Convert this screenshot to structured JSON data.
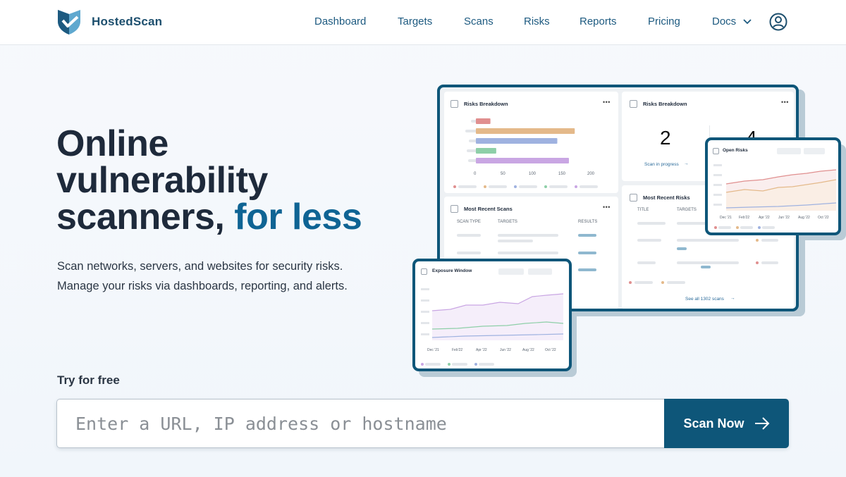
{
  "brand": {
    "name": "HostedScan"
  },
  "nav": {
    "items": [
      {
        "label": "Dashboard"
      },
      {
        "label": "Targets"
      },
      {
        "label": "Scans"
      },
      {
        "label": "Risks"
      },
      {
        "label": "Reports"
      },
      {
        "label": "Pricing"
      },
      {
        "label": "Docs"
      }
    ]
  },
  "hero": {
    "headline_line1": "Online",
    "headline_line2": "vulnerability",
    "headline_line3": "scanners,",
    "headline_accent": "for less",
    "subtext_line1": "Scan networks, servers, and websites for security risks.",
    "subtext_line2": "Manage your risks via dashboards, reporting, and alerts.",
    "try_label": "Try for free",
    "input_placeholder": "Enter a URL, IP address or hostname",
    "scan_button": "Scan Now"
  },
  "illustration": {
    "risks_breakdown_title": "Risks Breakdown",
    "risks_breakdown_axis": [
      "0",
      "50",
      "100",
      "150",
      "200"
    ],
    "risks_breakdown_bars": [
      {
        "value": 25,
        "color": "#e08f8f"
      },
      {
        "value": 170,
        "color": "#e4b98a"
      },
      {
        "value": 140,
        "color": "#9fb2e0"
      },
      {
        "value": 35,
        "color": "#8ecfa8"
      },
      {
        "value": 160,
        "color": "#c9a6e3"
      }
    ],
    "risks_breakdown2_title": "Risks Breakdown",
    "stat_value": "2",
    "stat_value2": "4",
    "scan_in_progress": "Scan in progress",
    "open_risks_title": "Open Risks",
    "open_risks_axis": [
      "Dec '21",
      "Feb'22",
      "Apr '22",
      "Jun '22",
      "Aug '22",
      "Oct '22"
    ],
    "most_recent_scans_title": "Most Recent Scans",
    "scans_cols": [
      "SCAN TYPE",
      "TARGETS",
      "RESULTS"
    ],
    "most_recent_risks_title": "Most Recent Risks",
    "risks_cols": [
      "TITLE",
      "TARGETS"
    ],
    "see_all_scans": "See all 1302 scans",
    "exposure_title": "Exposure Window",
    "exposure_axis": [
      "Dec '21",
      "Feb'22",
      "Apr '22",
      "Jun '22",
      "Aug '22",
      "Oct '22"
    ],
    "colors": {
      "accent": "#0e5679",
      "shadow": "#b9cbd6"
    }
  }
}
